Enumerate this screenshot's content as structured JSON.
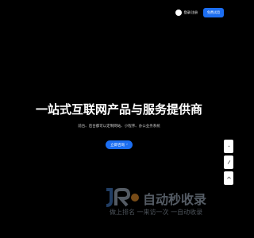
{
  "header": {
    "login_label": "登录/注册",
    "trial_label": "免费试用"
  },
  "hero": {
    "title": "一站式互联网产品与服务提供商",
    "subtitle": "前台、后台都可以定制网站、小程序、办公业务系统",
    "cta_label": "立即咨询",
    "cta_arrow": "›"
  },
  "side_tools": {
    "icons": [
      "chat-icon",
      "edit-icon",
      "arrow-up-icon"
    ]
  },
  "watermark": {
    "logo_text": "JR",
    "title": "自动秒收录",
    "subtitle": "做上排名 一来访一次 一自动收录"
  },
  "colors": {
    "background": "#000000",
    "accent": "#1c6ef2",
    "text": "#ffffff",
    "watermark": "#9aa7b6"
  }
}
